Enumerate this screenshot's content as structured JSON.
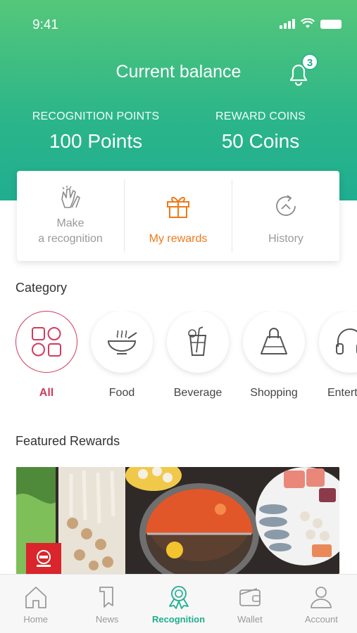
{
  "status_bar": {
    "time": "9:41"
  },
  "header": {
    "title": "Current balance",
    "notification_count": "3",
    "recognition_points": {
      "label": "RECOGNITION POINTS",
      "value": "100 Points"
    },
    "reward_coins": {
      "label": "REWARD COINS",
      "value": "50 Coins"
    }
  },
  "actions": [
    {
      "label_line1": "Make",
      "label_line2": "a recognition",
      "icon": "clap-hands-icon"
    },
    {
      "label": "My rewards",
      "icon": "gift-icon",
      "active": true
    },
    {
      "label": "History",
      "icon": "history-icon"
    }
  ],
  "category": {
    "title": "Category",
    "items": [
      {
        "label": "All",
        "icon": "grid-shapes-icon",
        "active": true
      },
      {
        "label": "Food",
        "icon": "bowl-icon"
      },
      {
        "label": "Beverage",
        "icon": "drink-icon"
      },
      {
        "label": "Shopping",
        "icon": "shopping-bag-icon"
      },
      {
        "label": "Entertain",
        "icon": "headphones-icon"
      }
    ]
  },
  "featured": {
    "title": "Featured Rewards"
  },
  "tabs": [
    {
      "label": "Home",
      "icon": "home-icon"
    },
    {
      "label": "News",
      "icon": "news-icon"
    },
    {
      "label": "Recognition",
      "icon": "award-icon",
      "active": true
    },
    {
      "label": "Wallet",
      "icon": "wallet-icon"
    },
    {
      "label": "Account",
      "icon": "user-icon"
    }
  ],
  "colors": {
    "brand_green": "#1fae8f",
    "accent_orange": "#ee7a1a",
    "category_active": "#d23a5e"
  }
}
